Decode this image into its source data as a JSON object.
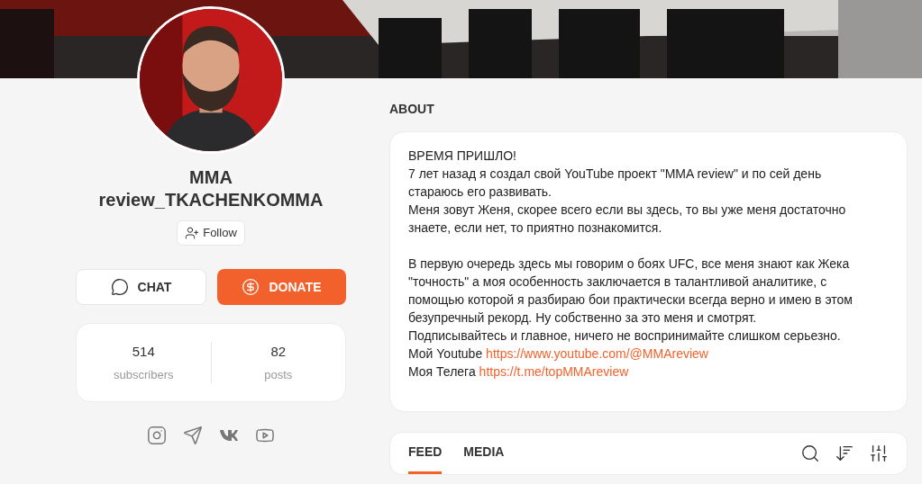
{
  "profile": {
    "name": "MMA review_TKACHENKOMMA",
    "follow": "Follow"
  },
  "actions": [
    {
      "kind": "chat",
      "label": "CHAT"
    },
    {
      "kind": "donate",
      "label": "DONATE"
    }
  ],
  "stats": [
    {
      "value": "514",
      "label": "subscribers"
    },
    {
      "value": "82",
      "label": "posts"
    }
  ],
  "about": {
    "title": "ABOUT",
    "blocks": [
      {
        "lines": [
          {
            "text": "ВРЕМЯ ПРИШЛО!"
          },
          {
            "text": "7 лет назад я создал свой YouTube проект \"MMA review\" и по сей день стараюсь его развивать."
          },
          {
            "text": "Меня зовут Женя, скорее всего если вы здесь, то вы уже меня достаточно знаете, если нет, то приятно познакомится."
          }
        ]
      },
      {
        "lines": [
          {
            "text": "В первую очередь здесь мы говорим о боях UFC, все меня знают как Жека \"точность\" а моя особенность заключается в талантливой аналитике, с помощью которой я разбираю бои практически всегда верно и имею в этом безупречный рекорд. Ну собственно за это меня и смотрят."
          },
          {
            "text": "Подписывайтесь и главное, ничего не воспринимайте слишком серьезно."
          },
          {
            "text": "Мой Youtube",
            "link": "https://www.youtube.com/@MMAreview"
          },
          {
            "text": "Моя Телега",
            "link": "https://t.me/topMMAreview"
          }
        ]
      }
    ]
  },
  "feed_tabs": [
    {
      "label": "FEED",
      "selected": true
    },
    {
      "label": "MEDIA",
      "selected": false
    }
  ]
}
